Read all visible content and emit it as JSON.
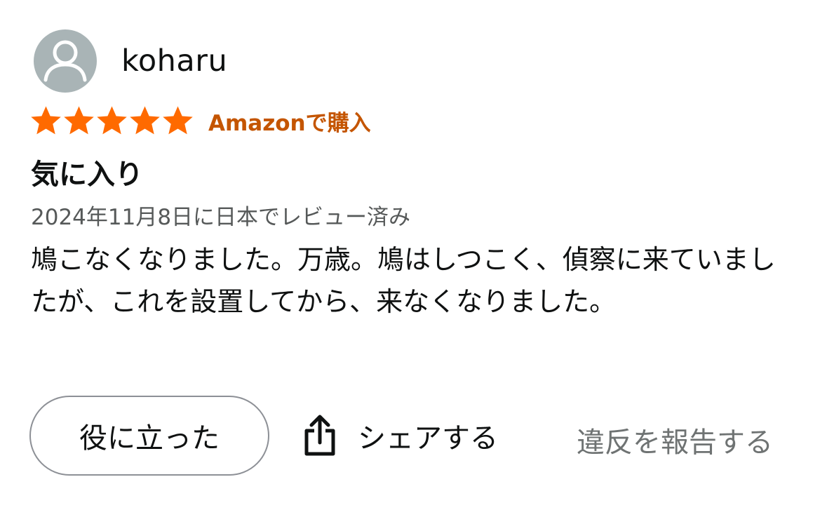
{
  "reviewer": {
    "name": "koharu"
  },
  "rating": {
    "stars": 5,
    "max": 5,
    "star_color": "#ff6a00",
    "verified_label": "Amazonで購入"
  },
  "review": {
    "title": "気に入り",
    "date": "2024年11月8日に日本でレビュー済み",
    "body": "鳩こなくなりました。万歳。鳩はしつこく、偵察に来ていましたが、これを設置してから、来なくなりました。"
  },
  "actions": {
    "helpful_label": "役に立った",
    "share_label": "シェアする",
    "report_label": "違反を報告する"
  },
  "colors": {
    "accent_orange": "#c45500",
    "star": "#ff6a00",
    "avatar_bg": "#a9b4b6",
    "secondary_text": "#565959",
    "button_border": "#8d9096"
  },
  "icons": {
    "avatar": "user-silhouette-icon",
    "star": "star-icon",
    "share": "share-icon"
  }
}
